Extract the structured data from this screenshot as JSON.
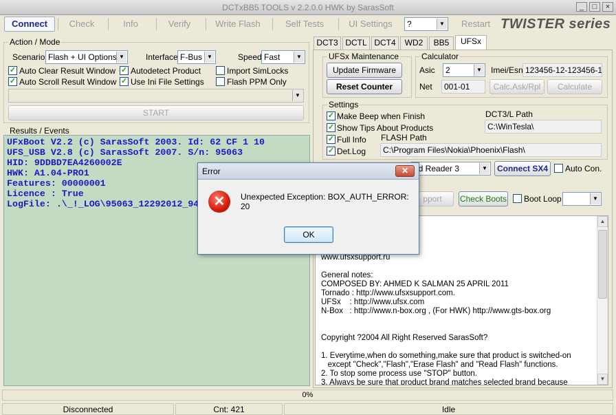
{
  "window": {
    "title": "DCTxBB5 TOOLS v 2.2.0.0 HWK by SarasSoft"
  },
  "toolbar": {
    "connect": "Connect",
    "check": "Check",
    "info": "Info",
    "verify": "Verify",
    "write_flash": "Write Flash",
    "self_tests": "Self Tests",
    "ui_settings": "UI Settings",
    "help_select": "?",
    "restart": "Restart",
    "brand": "TWISTER series"
  },
  "action_mode": {
    "legend": "Action / Mode",
    "scenario_label": "Scenario",
    "scenario_value": "Flash + UI Options",
    "interface_label": "Interface",
    "interface_value": "F-Bus",
    "speed_label": "Speed",
    "speed_value": "Fast",
    "auto_clear": "Auto Clear Result Window",
    "autodetect": "Autodetect Product",
    "import_simlocks": "Import SimLocks",
    "auto_scroll": "Auto Scroll Result Window",
    "use_ini": "Use Ini File Settings",
    "flash_ppm": "Flash PPM Only",
    "start": "START"
  },
  "results": {
    "legend": "Results / Events",
    "lines": [
      "UFxBoot V2.2 (c) SarasSoft 2003. Id: 62 CF 1 10",
      "UFS_USB V2.8 (c) SarasSoft 2007. S/n: 95063",
      "HID: 9DDBD7EA4260002E",
      "HWK: A1.04-PRO1",
      "Features: 00000001",
      "Licence : True",
      "LogFile: .\\_!_LOG\\95063_12292012_94"
    ]
  },
  "tabs": [
    "DCT3",
    "DCTL",
    "DCT4",
    "WD2",
    "BB5",
    "UFSx"
  ],
  "maintenance": {
    "legend": "UFSx Maintenance",
    "update_firmware": "Update Firmware",
    "reset_counter": "Reset Counter"
  },
  "calculator": {
    "legend": "Calculator",
    "asic_label": "Asic",
    "asic_value": "2",
    "imei_label": "Imei/Esn",
    "imei_value": "123456-12-123456-1",
    "net_label": "Net",
    "net_value": "001-01",
    "calc_ask": "Calc.Ask/Rpl",
    "calculate": "Calculate"
  },
  "settings": {
    "legend": "Settings",
    "make_beep": "Make Beep when Finish",
    "show_tips": "Show Tips About Products",
    "full_info": "Full Info",
    "det_log": "Det.Log",
    "dct3_path_label": "DCT3/L Path",
    "dct3_path_value": "C:\\WinTesla\\",
    "flash_path_label": "FLASH  Path",
    "flash_path_value": "C:\\Program Files\\Nokia\\Phoenix\\Flash\\"
  },
  "reader": {
    "reader_value": "nd Reader 3",
    "connect_sx4": "Connect SX4",
    "auto_con": "Auto Con.",
    "support_btn": "pport",
    "check_boots": "Check Boots",
    "boot_loop": "Boot Loop"
  },
  "info_text": [
    "www.ufsxsupport.ru",
    "",
    "General notes:",
    "COMPOSED BY: AHMED K SALMAN 25 APRIL 2011",
    "Tornado : http://www.ufsxsupport.com.",
    "UFSx    : http://www.ufsx.com",
    "N-Box   : http://www.n-box.org , (For HWK) http://www.gts-box.org",
    "",
    "",
    "Copyright ?2004 All Right Reserved SarasSoft?",
    "",
    "1. Everytime,when do something,make sure that product is switched-on",
    "   except \"Check\",\"Flash\",\"Erase Flash\" and \"Read Flash\" functions.",
    "2. To stop some process use \"STOP\" button.",
    "3. Always be sure that product brand matches selected brand because"
  ],
  "progress": {
    "text": "0%",
    "value_pct": 0
  },
  "status": {
    "connection": "Disconnected",
    "count": "Cnt: 421",
    "state": "Idle"
  },
  "dialog": {
    "title": "Error",
    "close": "✕",
    "icon": "error-icon",
    "message": "Unexpected Exception: BOX_AUTH_ERROR: 20",
    "ok": "OK"
  }
}
